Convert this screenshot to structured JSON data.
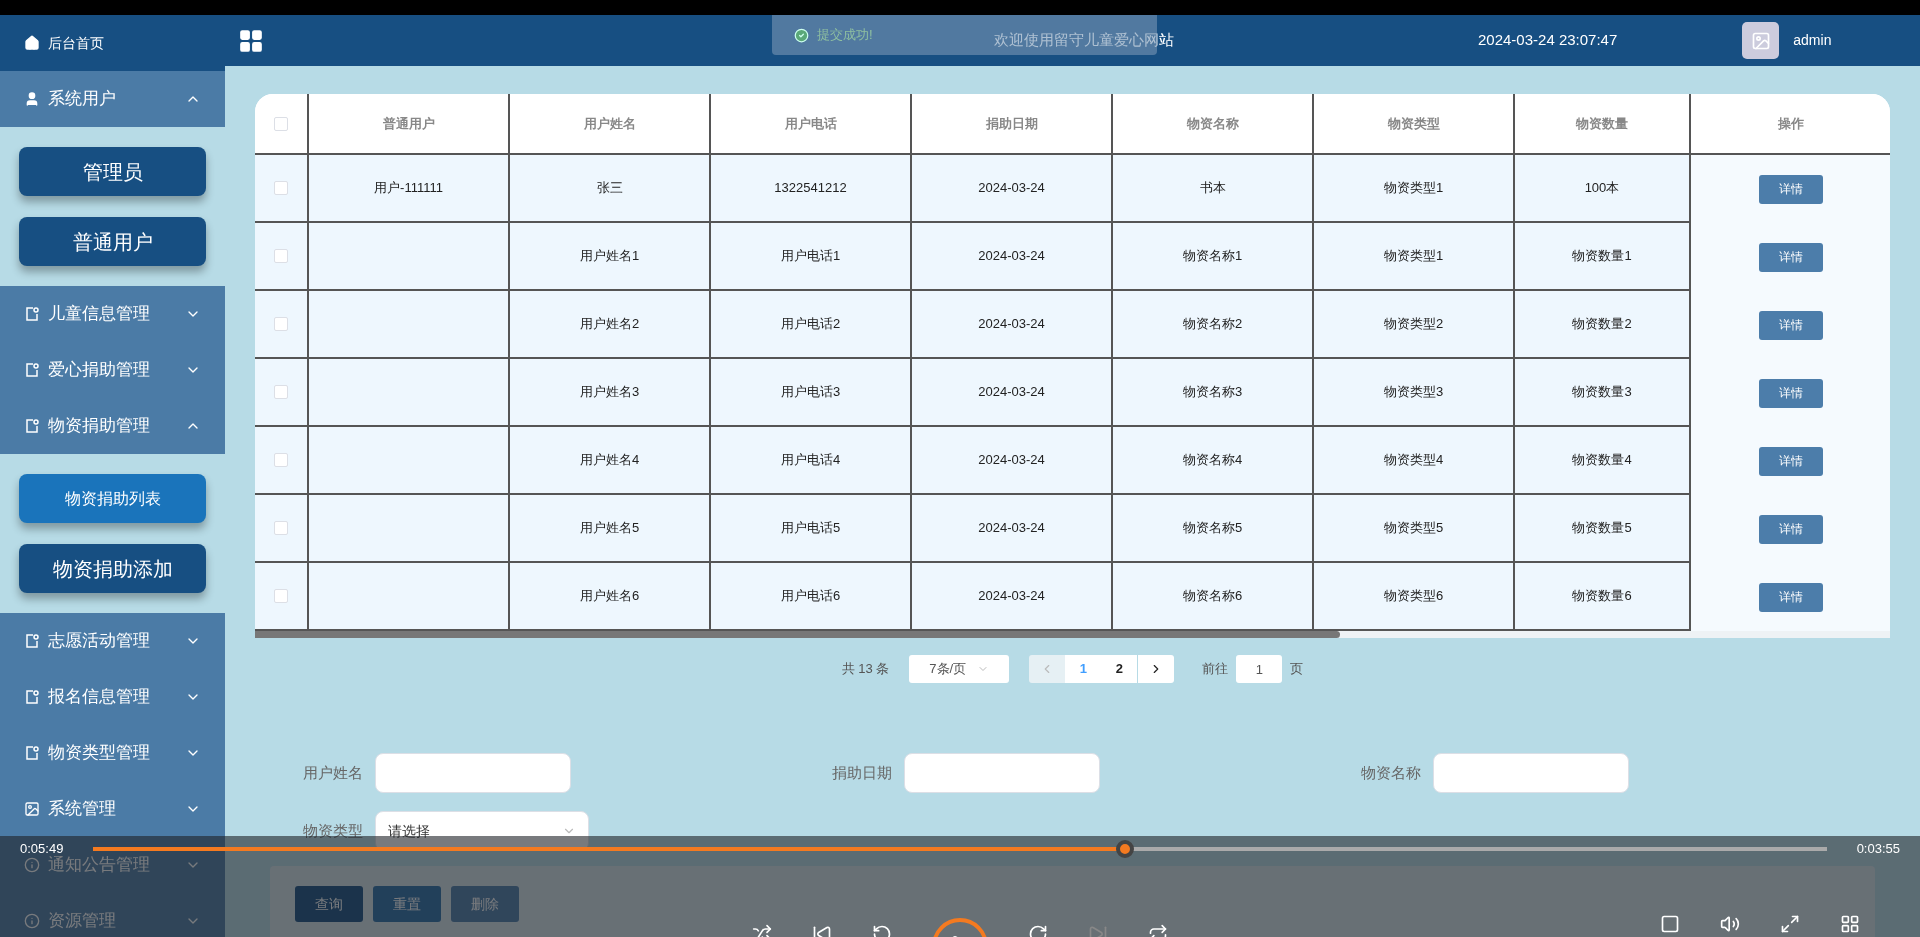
{
  "sidebar": {
    "items": [
      {
        "kind": "link",
        "label": "后台首页"
      },
      {
        "kind": "group",
        "label": "系统用户",
        "expanded": true,
        "children": [
          {
            "label": "管理员",
            "selected": false
          },
          {
            "label": "普通用户",
            "selected": false
          }
        ]
      },
      {
        "kind": "group",
        "label": "儿童信息管理",
        "expanded": false
      },
      {
        "kind": "group",
        "label": "爱心捐助管理",
        "expanded": false
      },
      {
        "kind": "group",
        "label": "物资捐助管理",
        "expanded": true,
        "children": [
          {
            "label": "物资捐助列表",
            "selected": true
          },
          {
            "label": "物资捐助添加",
            "selected": false
          }
        ]
      },
      {
        "kind": "group",
        "label": "志愿活动管理",
        "expanded": false
      },
      {
        "kind": "group",
        "label": "报名信息管理",
        "expanded": false
      },
      {
        "kind": "group",
        "label": "物资类型管理",
        "expanded": false
      },
      {
        "kind": "group",
        "label": "系统管理",
        "expanded": false
      },
      {
        "kind": "group",
        "label": "通知公告管理",
        "expanded": false
      },
      {
        "kind": "group",
        "label": "资源管理",
        "expanded": false
      }
    ]
  },
  "header": {
    "title": "欢迎使用留守儿童爱心网站",
    "datetime": "2024-03-24 23:07:47",
    "user": "admin"
  },
  "toast": {
    "message": "提交成功!"
  },
  "table": {
    "all_checked": false,
    "columns": [
      "普通用户",
      "用户姓名",
      "用户电话",
      "捐助日期",
      "物资名称",
      "物资类型",
      "物资数量",
      "操作"
    ],
    "rows": [
      {
        "checked": false,
        "cells": [
          "用户-111111",
          "张三",
          "1322541212",
          "2024-03-24",
          "书本",
          "物资类型1",
          "100本"
        ],
        "action": "详情"
      },
      {
        "checked": false,
        "cells": [
          "",
          "用户姓名1",
          "用户电话1",
          "2024-03-24",
          "物资名称1",
          "物资类型1",
          "物资数量1"
        ],
        "action": "详情"
      },
      {
        "checked": false,
        "cells": [
          "",
          "用户姓名2",
          "用户电话2",
          "2024-03-24",
          "物资名称2",
          "物资类型2",
          "物资数量2"
        ],
        "action": "详情"
      },
      {
        "checked": false,
        "cells": [
          "",
          "用户姓名3",
          "用户电话3",
          "2024-03-24",
          "物资名称3",
          "物资类型3",
          "物资数量3"
        ],
        "action": "详情"
      },
      {
        "checked": false,
        "cells": [
          "",
          "用户姓名4",
          "用户电话4",
          "2024-03-24",
          "物资名称4",
          "物资类型4",
          "物资数量4"
        ],
        "action": "详情"
      },
      {
        "checked": false,
        "cells": [
          "",
          "用户姓名5",
          "用户电话5",
          "2024-03-24",
          "物资名称5",
          "物资类型5",
          "物资数量5"
        ],
        "action": "详情"
      },
      {
        "checked": false,
        "cells": [
          "",
          "用户姓名6",
          "用户电话6",
          "2024-03-24",
          "物资名称6",
          "物资类型6",
          "物资数量6"
        ],
        "action": "详情"
      }
    ]
  },
  "pagination": {
    "total": "共 13 条",
    "page_size": "7条/页",
    "pages": [
      {
        "label": "1",
        "selected": true
      },
      {
        "label": "2",
        "selected": false
      }
    ],
    "goto_label": "前往",
    "goto_value": "1",
    "goto_suffix": "页"
  },
  "search": {
    "fields": [
      {
        "kind": "input",
        "label": "用户姓名"
      },
      {
        "kind": "input",
        "label": "捐助日期"
      },
      {
        "kind": "input",
        "label": "物资名称"
      },
      {
        "kind": "select",
        "label": "物资类型",
        "value": "请选择"
      }
    ],
    "buttons": [
      "查询",
      "重置",
      "删除"
    ]
  },
  "player": {
    "elapsed": "0:05:49",
    "remaining": "0:03:55",
    "level": 0.595
  }
}
